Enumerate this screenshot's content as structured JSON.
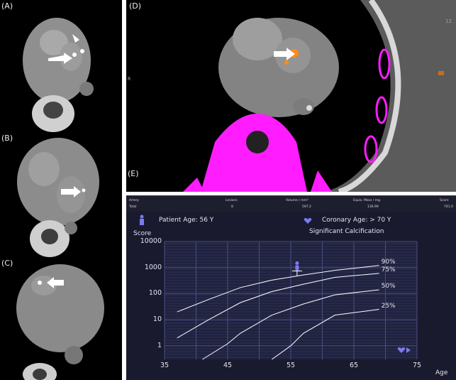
{
  "panels": {
    "a": {
      "label": "(A)"
    },
    "b": {
      "label": "(B)"
    },
    "c": {
      "label": "(C)"
    },
    "d": {
      "label": "(D)",
      "side_marker": "R",
      "scale_mark": "12"
    },
    "e": {
      "label": "(E)"
    }
  },
  "table": {
    "headers": [
      "Artery",
      "Lesions",
      "Volume / mm³",
      "Equiv. Mass / mg",
      "Score"
    ],
    "row": [
      "Total",
      "8",
      "597.2",
      "136.99",
      "741.0"
    ]
  },
  "score": {
    "score_label": "Score",
    "patient_age": "Patient Age: 56 Y",
    "coronary_age": "Coronary Age: > 70 Y",
    "significance": "Significant Calcification"
  },
  "chart_data": {
    "type": "line",
    "y_scale": "log",
    "ylim": [
      0.3,
      10000
    ],
    "xlim": [
      35,
      75
    ],
    "y_ticks": [
      "10000",
      "1000",
      "100",
      "10",
      "1"
    ],
    "x_ticks": [
      "35",
      "45",
      "55",
      "65",
      "75"
    ],
    "xlabel": "Age",
    "series": [
      {
        "name": "90%",
        "x": [
          37,
          42,
          47,
          52,
          57,
          62,
          69
        ],
        "y": [
          20,
          60,
          170,
          330,
          520,
          780,
          1200
        ]
      },
      {
        "name": "75%",
        "x": [
          37,
          42,
          47,
          52,
          57,
          62,
          69
        ],
        "y": [
          2,
          10,
          45,
          120,
          230,
          420,
          600
        ]
      },
      {
        "name": "50%",
        "x": [
          41,
          45,
          47,
          52,
          57,
          62,
          69
        ],
        "y": [
          0.3,
          1.2,
          3,
          15,
          40,
          90,
          140
        ]
      },
      {
        "name": "25%",
        "x": [
          52,
          55,
          57,
          62,
          69
        ],
        "y": [
          0.3,
          1,
          3,
          15,
          25
        ]
      }
    ],
    "patient_point": {
      "x": 56,
      "y": 741
    },
    "grid": true
  },
  "colors": {
    "calcium_overlay": "#ff1dff",
    "lesion": "#ff8a1a",
    "panel_bg": "#191a2e"
  }
}
